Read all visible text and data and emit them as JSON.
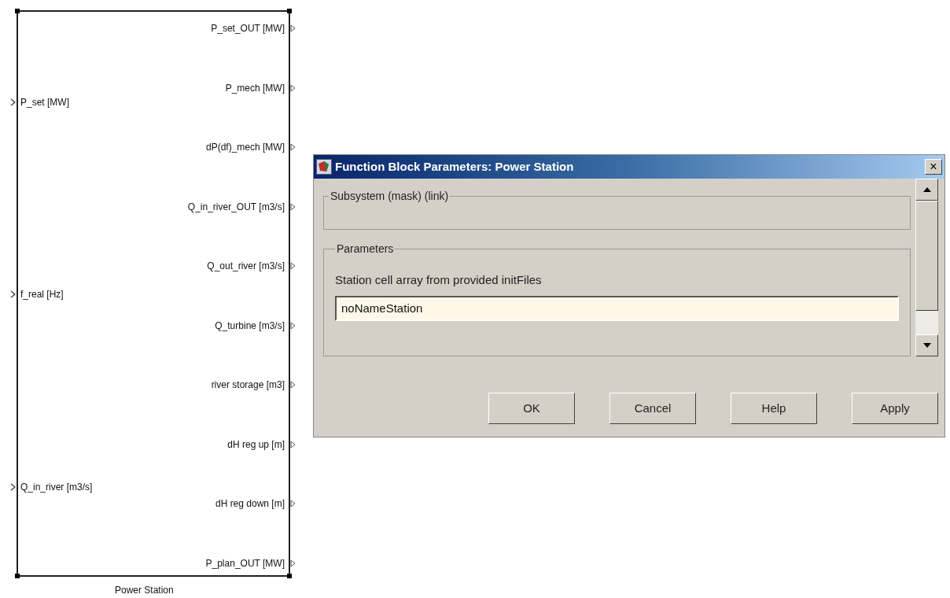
{
  "block": {
    "name": "Power Station",
    "inputs": [
      "P_set [MW]",
      "f_real [Hz]",
      "Q_in_river [m3/s]"
    ],
    "outputs": [
      "P_set_OUT [MW]",
      "P_mech [MW]",
      "dP(df)_mech [MW]",
      "Q_in_river_OUT [m3/s]",
      "Q_out_river [m3/s]",
      "Q_turbine [m3/s]",
      "river storage [m3]",
      "dH reg up [m]",
      "dH reg down [m]",
      "P_plan_OUT [MW]"
    ]
  },
  "dialog": {
    "title": "Function Block Parameters: Power Station",
    "close": "×",
    "description_group": {
      "title": "Subsystem (mask) (link)"
    },
    "parameters_group": {
      "title": "Parameters",
      "field_label": "Station cell array from provided initFiles",
      "field_value": "noNameStation"
    },
    "buttons": [
      "OK",
      "Cancel",
      "Help",
      "Apply"
    ]
  }
}
